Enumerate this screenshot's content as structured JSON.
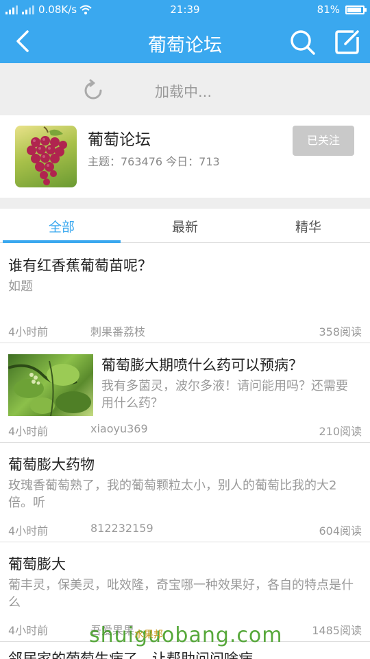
{
  "status_bar": {
    "speed": "0.08K/s",
    "time": "21:39",
    "battery": "81%"
  },
  "nav": {
    "title": "葡萄论坛"
  },
  "loading": {
    "text": "加载中..."
  },
  "forum": {
    "name": "葡萄论坛",
    "stats": "主题：763476  今日：713",
    "follow_label": "已关注"
  },
  "tabs": [
    {
      "label": "全部"
    },
    {
      "label": "最新"
    },
    {
      "label": "精华"
    }
  ],
  "posts": [
    {
      "title": "谁有红香蕉葡萄苗呢？",
      "desc": "如题",
      "time": "4小时前",
      "author": "刺果番荔枝",
      "reads": "358阅读"
    },
    {
      "title": "葡萄膨大期喷什么药可以预病？",
      "desc": "我有多菌灵，波尔多液！请问能用吗？还需要用什么药？",
      "time": "4小时前",
      "author": "xiaoyu369",
      "reads": "210阅读"
    },
    {
      "title": "葡萄膨大药物",
      "desc": "玫瑰香葡萄熟了，我的葡萄颗粒太小，别人的葡萄比我的大2倍。听",
      "time": "4小时前",
      "author": "812232159",
      "reads": "604阅读"
    },
    {
      "title": "葡萄膨大",
      "desc": "葡丰灵，保美灵，吡效隆，奇宝哪一种效果好，各自的特点是什么",
      "time": "4小时前",
      "author": "吾爱果果",
      "reads": "1485阅读"
    }
  ],
  "peek_title": "邻居家的葡萄生病了，让帮助问问啥病",
  "watermark": {
    "text": "shuiguobang.com",
    "cn": "水果邦"
  }
}
